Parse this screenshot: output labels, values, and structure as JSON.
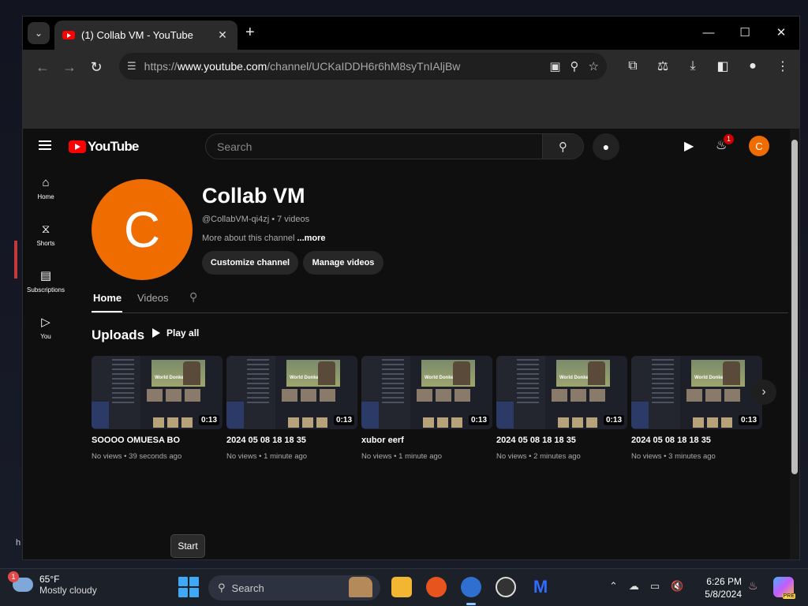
{
  "browser": {
    "tab_title": "(1) Collab VM - YouTube",
    "url_prefix": "https://",
    "url_host": "www.youtube.com",
    "url_path": "/channel/UCKaIDDH6r6hM8syTnIAljBw"
  },
  "youtube": {
    "logo_text": "YouTube",
    "search_placeholder": "Search",
    "notification_count": "1",
    "account_initial": "C",
    "sidebar": [
      {
        "label": "Home",
        "icon": "home-icon"
      },
      {
        "label": "Shorts",
        "icon": "shorts-icon"
      },
      {
        "label": "Subscriptions",
        "icon": "subscriptions-icon"
      },
      {
        "label": "You",
        "icon": "you-icon"
      }
    ],
    "channel": {
      "avatar_letter": "C",
      "name": "Collab VM",
      "handle": "@CollabVM-qi4zj",
      "video_count": "7 videos",
      "about": "More about this channel",
      "more": "...more",
      "customize_label": "Customize channel",
      "manage_label": "Manage videos"
    },
    "tabs": [
      "Home",
      "Videos"
    ],
    "uploads_heading": "Uploads",
    "play_all": "Play all",
    "videos": [
      {
        "title": "SOOOO OMUESA BO",
        "views": "No views",
        "age": "39 seconds ago",
        "duration": "0:13"
      },
      {
        "title": "2024 05 08 18 18 35",
        "views": "No views",
        "age": "1 minute ago",
        "duration": "0:13"
      },
      {
        "title": "xubor eerf",
        "views": "No views",
        "age": "1 minute ago",
        "duration": "0:13"
      },
      {
        "title": "2024 05 08 18 18 35",
        "views": "No views",
        "age": "2 minutes ago",
        "duration": "0:13"
      },
      {
        "title": "2024 05 08 18 18 35",
        "views": "No views",
        "age": "3 minutes ago",
        "duration": "0:13"
      }
    ],
    "thumb_caption": "World Donkey Day"
  },
  "tooltip": {
    "start": "Start"
  },
  "taskbar": {
    "weather_badge": "1",
    "temperature": "65°F",
    "condition": "Mostly cloudy",
    "search_label": "Search",
    "time": "6:26 PM",
    "date": "5/8/2024",
    "copilot_badge": "PRE"
  }
}
